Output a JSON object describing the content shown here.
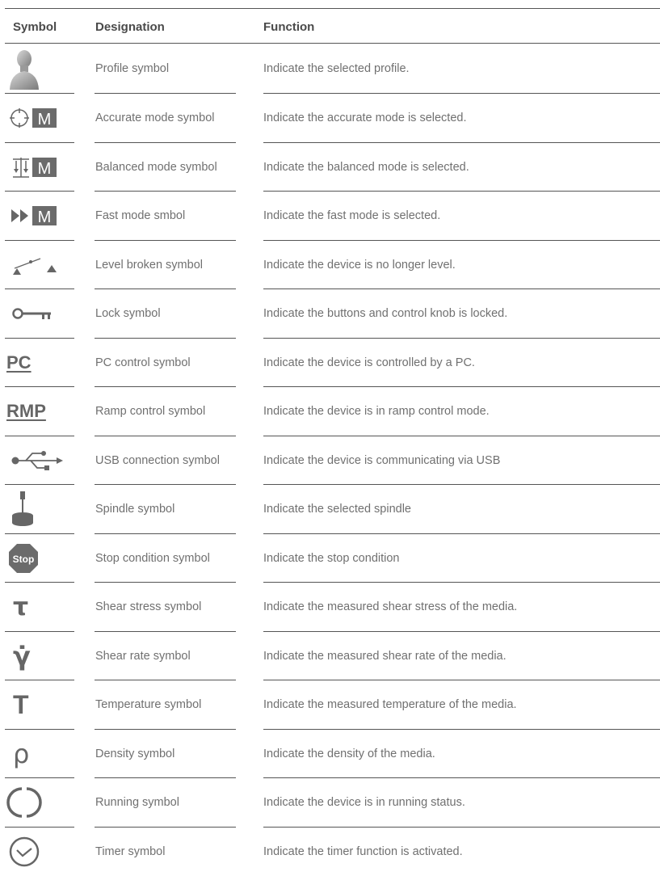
{
  "header": {
    "symbol": "Symbol",
    "designation": "Designation",
    "function": "Function"
  },
  "rows": [
    {
      "icon": "profile-bust-icon",
      "designation": "Profile symbol",
      "function": "Indicate the selected profile."
    },
    {
      "icon": "crosshair-m-icon",
      "symbol_text": "M",
      "designation": "Accurate mode symbol",
      "function": "Indicate the accurate mode is selected."
    },
    {
      "icon": "balance-m-icon",
      "symbol_text": "M",
      "designation": "Balanced mode symbol",
      "function": "Indicate the balanced mode is selected."
    },
    {
      "icon": "fast-forward-m-icon",
      "symbol_text": "M",
      "designation": "Fast mode smbol",
      "function": "Indicate the fast mode is selected."
    },
    {
      "icon": "level-broken-icon",
      "designation": "Level broken symbol",
      "function": "Indicate the device is no longer level."
    },
    {
      "icon": "key-icon",
      "designation": "Lock symbol",
      "function": "Indicate the buttons and control knob is locked."
    },
    {
      "icon": "pc-text-icon",
      "symbol_text": "PC",
      "designation": "PC control symbol",
      "function": "Indicate the device is controlled by a PC."
    },
    {
      "icon": "rmp-text-icon",
      "symbol_text": "RMP",
      "designation": "Ramp control symbol",
      "function": "Indicate the device is in ramp control mode."
    },
    {
      "icon": "usb-icon",
      "designation": "USB connection symbol",
      "function": "Indicate the device is communicating via USB"
    },
    {
      "icon": "spindle-icon",
      "designation": "Spindle symbol",
      "function": "Indicate the selected spindle"
    },
    {
      "icon": "stop-sign-icon",
      "symbol_text": "Stop",
      "designation": "Stop condition symbol",
      "function": "Indicate the stop condition"
    },
    {
      "icon": "tau-icon",
      "symbol_text": "τ",
      "designation": "Shear stress symbol",
      "function": "Indicate the measured shear stress of the media."
    },
    {
      "icon": "gamma-dot-icon",
      "symbol_text": "γ̇",
      "designation": "Shear rate symbol",
      "function": "Indicate the measured shear rate of the media."
    },
    {
      "icon": "temperature-t-icon",
      "symbol_text": "T",
      "designation": "Temperature symbol",
      "function": "Indicate the measured temperature of the media."
    },
    {
      "icon": "rho-icon",
      "symbol_text": "ρ",
      "designation": "Density symbol",
      "function": "Indicate the density of the media."
    },
    {
      "icon": "running-circle-icon",
      "designation": "Running symbol",
      "function": "Indicate the device is in running status."
    },
    {
      "icon": "timer-clock-icon",
      "designation": "Timer symbol",
      "function": "Indicate the timer function is activated."
    }
  ]
}
